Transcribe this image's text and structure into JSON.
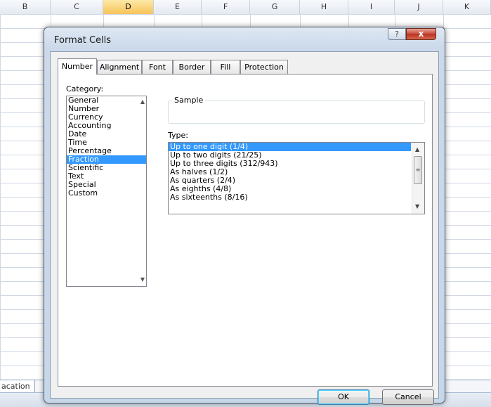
{
  "spreadsheet": {
    "columns": [
      "B",
      "C",
      "D",
      "E",
      "F",
      "G",
      "H",
      "I",
      "J",
      "K"
    ],
    "active_column": "D",
    "sheet_tab": "acation"
  },
  "dialog": {
    "title": "Format Cells",
    "help_glyph": "?",
    "close_glyph": "x",
    "tabs": [
      {
        "label": "Number",
        "selected": true
      },
      {
        "label": "Alignment",
        "selected": false
      },
      {
        "label": "Font",
        "selected": false
      },
      {
        "label": "Border",
        "selected": false
      },
      {
        "label": "Fill",
        "selected": false
      },
      {
        "label": "Protection",
        "selected": false
      }
    ],
    "category_label": "Category:",
    "categories": [
      "General",
      "Number",
      "Currency",
      "Accounting",
      "Date",
      "Time",
      "Percentage",
      "Fraction",
      "Scientific",
      "Text",
      "Special",
      "Custom"
    ],
    "selected_category": "Fraction",
    "sample_label": "Sample",
    "type_label": "Type:",
    "types": [
      "Up to one digit (1/4)",
      "Up to two digits (21/25)",
      "Up to three digits (312/943)",
      "As halves (1/2)",
      "As quarters (2/4)",
      "As eighths (4/8)",
      "As sixteenths (8/16)"
    ],
    "selected_type": "Up to one digit (1/4)",
    "buttons": {
      "ok": "OK",
      "cancel": "Cancel"
    },
    "icons": {
      "scroll_up": "scroll-up-arrow-icon",
      "scroll_down": "scroll-down-arrow-icon",
      "thumb_grip": "scroll-thumb-grip-icon"
    }
  }
}
